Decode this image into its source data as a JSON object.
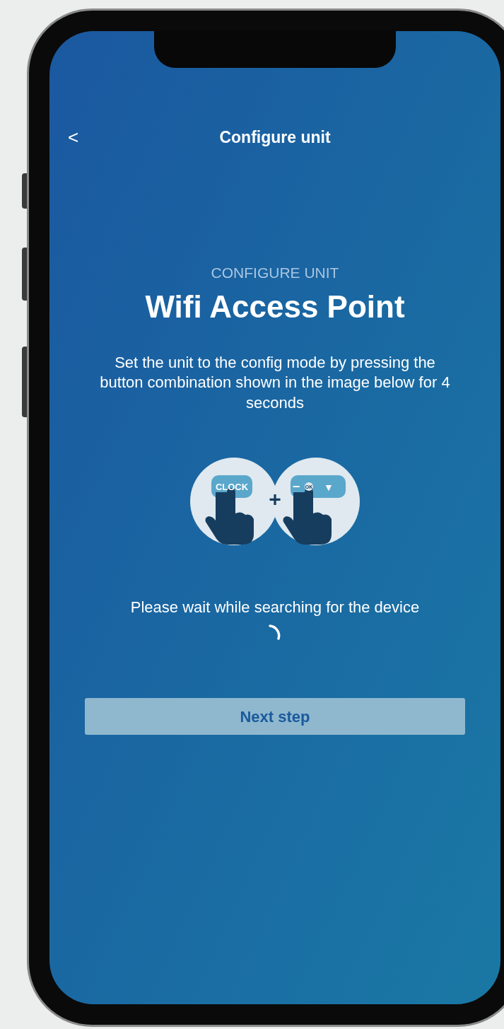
{
  "header": {
    "back": "<",
    "title": "Configure unit"
  },
  "step": {
    "eyebrow": "CONFIGURE UNIT",
    "title": "Wifi Access Point",
    "instructions": "Set the unit to the config mode by pressing the button combination shown in the image below for 4 seconds"
  },
  "illustration": {
    "left_key": "CLOCK",
    "plus": "+",
    "right_keys": [
      "−",
      "OK",
      "▼"
    ]
  },
  "status": {
    "message": "Please wait while searching for the device",
    "searching": true
  },
  "next_button": {
    "label": "Next step",
    "disabled": true
  }
}
